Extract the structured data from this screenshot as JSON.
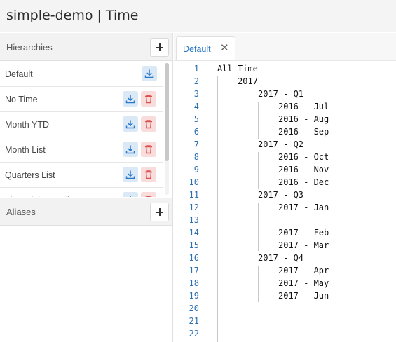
{
  "app": {
    "title": "simple-demo | Time"
  },
  "hierarchies": {
    "title": "Hierarchies",
    "items": [
      {
        "label": "Default",
        "deletable": false
      },
      {
        "label": "No Time",
        "deletable": true
      },
      {
        "label": "Month YTD",
        "deletable": true
      },
      {
        "label": "Month List",
        "deletable": true
      },
      {
        "label": "Quarters List",
        "deletable": true
      },
      {
        "label": "Financial Year List",
        "deletable": true
      }
    ]
  },
  "aliases": {
    "title": "Aliases"
  },
  "tabs": [
    {
      "label": "Default",
      "close_glyph": "✕"
    }
  ],
  "editor": {
    "lines": [
      {
        "n": "1",
        "indent": 0,
        "text": "All Time"
      },
      {
        "n": "2",
        "indent": 1,
        "text": "2017"
      },
      {
        "n": "3",
        "indent": 2,
        "text": "2017 - Q1"
      },
      {
        "n": "4",
        "indent": 3,
        "text": "2016 - Jul"
      },
      {
        "n": "5",
        "indent": 3,
        "text": "2016 - Aug"
      },
      {
        "n": "6",
        "indent": 3,
        "text": "2016 - Sep"
      },
      {
        "n": "7",
        "indent": 2,
        "text": "2017 - Q2"
      },
      {
        "n": "8",
        "indent": 3,
        "text": "2016 - Oct"
      },
      {
        "n": "9",
        "indent": 3,
        "text": "2016 - Nov"
      },
      {
        "n": "10",
        "indent": 3,
        "text": "2016 - Dec"
      },
      {
        "n": "11",
        "indent": 2,
        "text": "2017 - Q3"
      },
      {
        "n": "12",
        "indent": 3,
        "text": "2017 - Jan"
      },
      {
        "n": "13",
        "indent": 0,
        "text": ""
      },
      {
        "n": "14",
        "indent": 3,
        "text": "2017 - Feb"
      },
      {
        "n": "15",
        "indent": 3,
        "text": "2017 - Mar"
      },
      {
        "n": "16",
        "indent": 2,
        "text": "2017 - Q4"
      },
      {
        "n": "17",
        "indent": 3,
        "text": "2017 - Apr"
      },
      {
        "n": "18",
        "indent": 3,
        "text": "2017 - May"
      },
      {
        "n": "19",
        "indent": 3,
        "text": "2017 - Jun"
      },
      {
        "n": "20",
        "indent": 0,
        "text": ""
      },
      {
        "n": "21",
        "indent": 0,
        "text": ""
      },
      {
        "n": "22",
        "indent": 0,
        "text": ""
      }
    ]
  },
  "colors": {
    "accent": "#2a78c8",
    "line_number": "#2a6fae",
    "download_bg": "#dbe9f7",
    "delete_bg": "#f9dcdc",
    "delete_icon": "#d9534f"
  },
  "icons": {
    "add": "plus-icon",
    "download": "download-icon",
    "delete": "trash-icon",
    "close": "close-icon"
  }
}
